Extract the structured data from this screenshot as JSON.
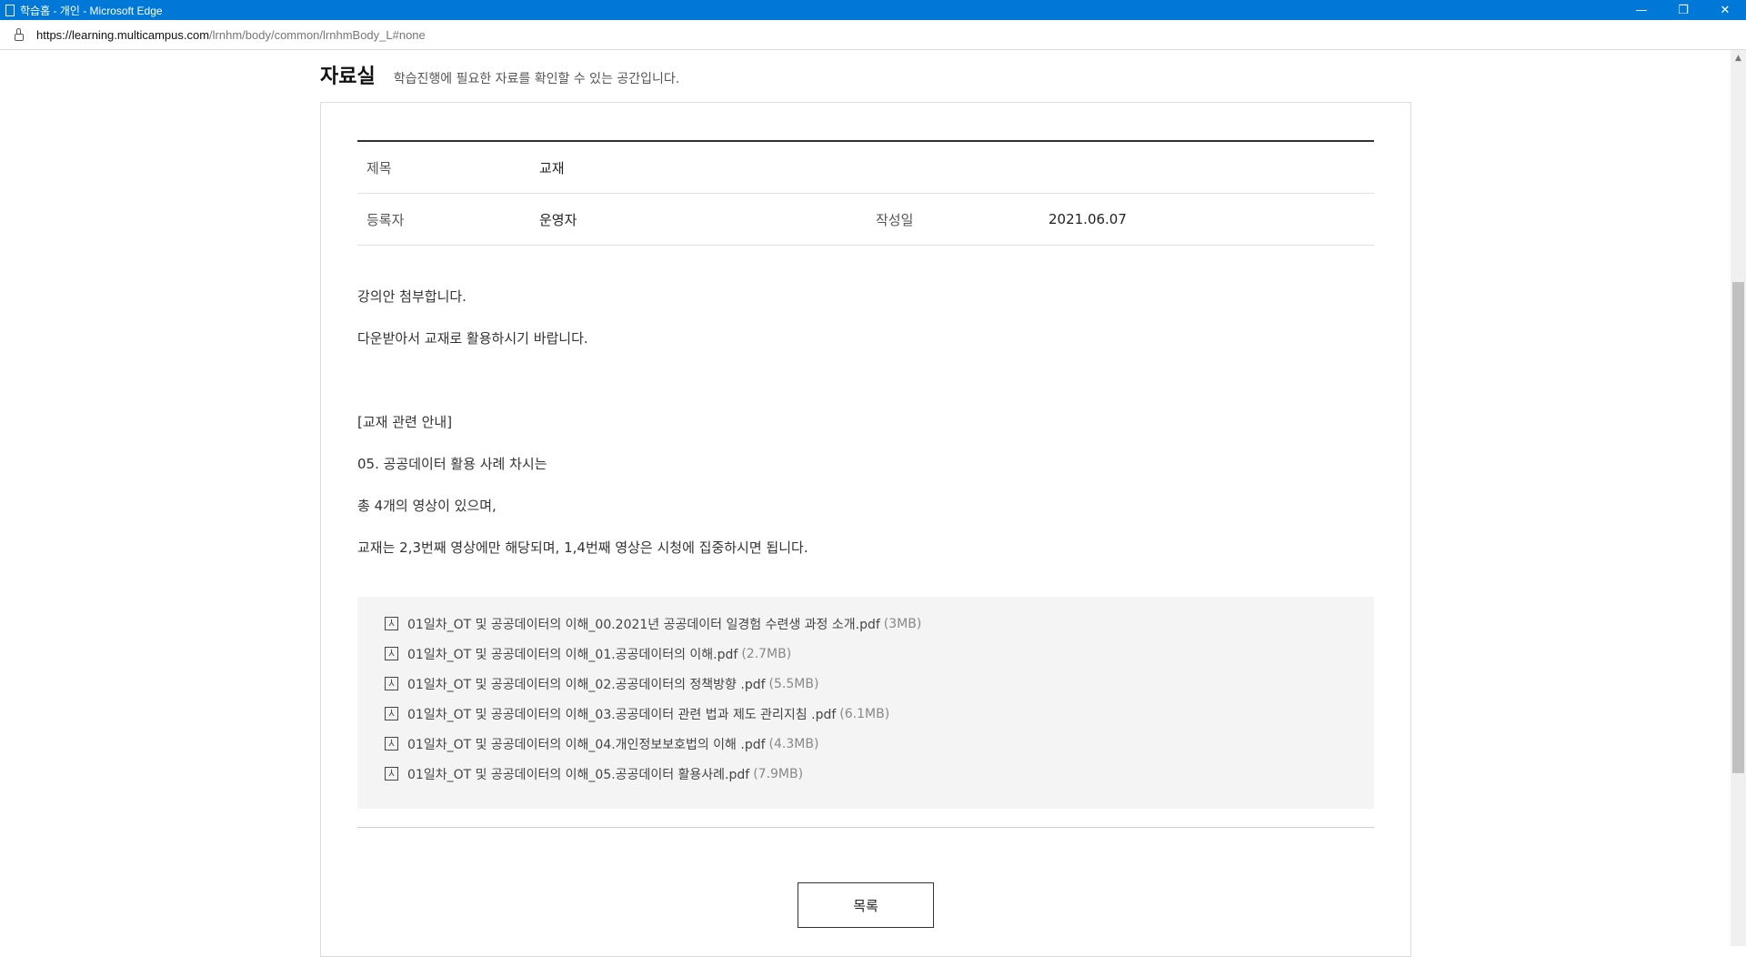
{
  "window": {
    "title": "학습홈 - 개인 - Microsoft Edge",
    "controls": {
      "minimize": "—",
      "restore": "❐",
      "close": "✕"
    }
  },
  "address": {
    "url_host": "https://learning.multicampus.com",
    "url_path": "/lrnhm/body/common/lrnhmBody_L#none"
  },
  "page": {
    "title": "자료실",
    "subtitle": "학습진행에 필요한 자료를 확인할 수 있는 공간입니다."
  },
  "post": {
    "subject_label": "제목",
    "subject_value": "교재",
    "author_label": "등록자",
    "author_value": "운영자",
    "date_label": "작성일",
    "date_value": "2021.06.07",
    "body": [
      "강의안 첨부합니다.",
      "다운받아서 교재로 활용하시기 바랍니다.",
      "",
      "[교재 관련 안내]",
      "05. 공공데이터 활용 사례 차시는",
      "총 4개의 영상이 있으며,",
      "교재는 2,3번째 영상에만 해당되며, 1,4번째 영상은 시청에 집중하시면 됩니다."
    ]
  },
  "attachments": [
    {
      "name": "01일차_OT 및 공공데이터의 이해_00.2021년 공공데이터 일경험 수련생 과정 소개.pdf",
      "size": "(3MB)"
    },
    {
      "name": "01일차_OT 및 공공데이터의 이해_01.공공데이터의 이해.pdf",
      "size": "(2.7MB)"
    },
    {
      "name": "01일차_OT 및 공공데이터의 이해_02.공공데이터의 정책방향 .pdf",
      "size": "(5.5MB)"
    },
    {
      "name": "01일차_OT 및 공공데이터의 이해_03.공공데이터 관련 법과 제도 관리지침 .pdf",
      "size": "(6.1MB)"
    },
    {
      "name": "01일차_OT 및 공공데이터의 이해_04.개인정보보호법의 이해 .pdf",
      "size": "(4.3MB)"
    },
    {
      "name": "01일차_OT 및 공공데이터의 이해_05.공공데이터 활용사례.pdf",
      "size": "(7.9MB)"
    }
  ],
  "buttons": {
    "list_label": "목록"
  },
  "icons": {
    "attachment": "pdf-icon"
  },
  "colors": {
    "titlebar": "#0078d7",
    "attach_bg": "#f4f4f4"
  }
}
